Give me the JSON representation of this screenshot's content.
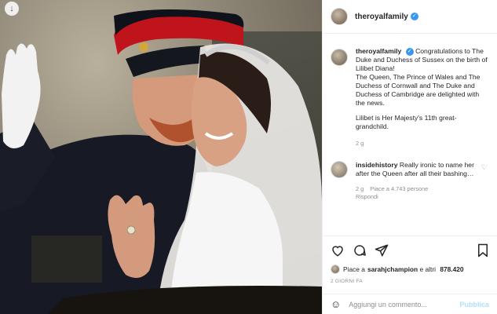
{
  "post": {
    "username": "theroyalfamily",
    "caption": {
      "username": "theroyalfamily",
      "line1": "Congratulations to The Duke and Duchess of Sussex on the birth of Lilibet Diana!",
      "line2": "The Queen, The Prince of Wales and The Duchess of Cornwall and The Duke and Duchess of Cambridge are delighted with the news.",
      "line3": "Lilibet is Her Majesty's 11th great-grandchild.",
      "age": "2 g"
    },
    "comment": {
      "username": "insidehistory",
      "text": "Really ironic to name her after the Queen after all their bashing…",
      "age": "2 g",
      "likes": "Piace a 4.743 persone",
      "reply": "Rispondi"
    },
    "likes": {
      "prefix": "Piace a ",
      "user": "sarahjchampion",
      "suffix": " e altri ",
      "count": "878.420"
    },
    "date": "2 GIORNI FA",
    "add_comment_placeholder": "Aggiungi un commento...",
    "publish_label": "Pubblica"
  },
  "colors": {
    "accent": "#3897f0",
    "publish_disabled": "#b2dffc",
    "meta_gray": "#8e8e8e"
  }
}
